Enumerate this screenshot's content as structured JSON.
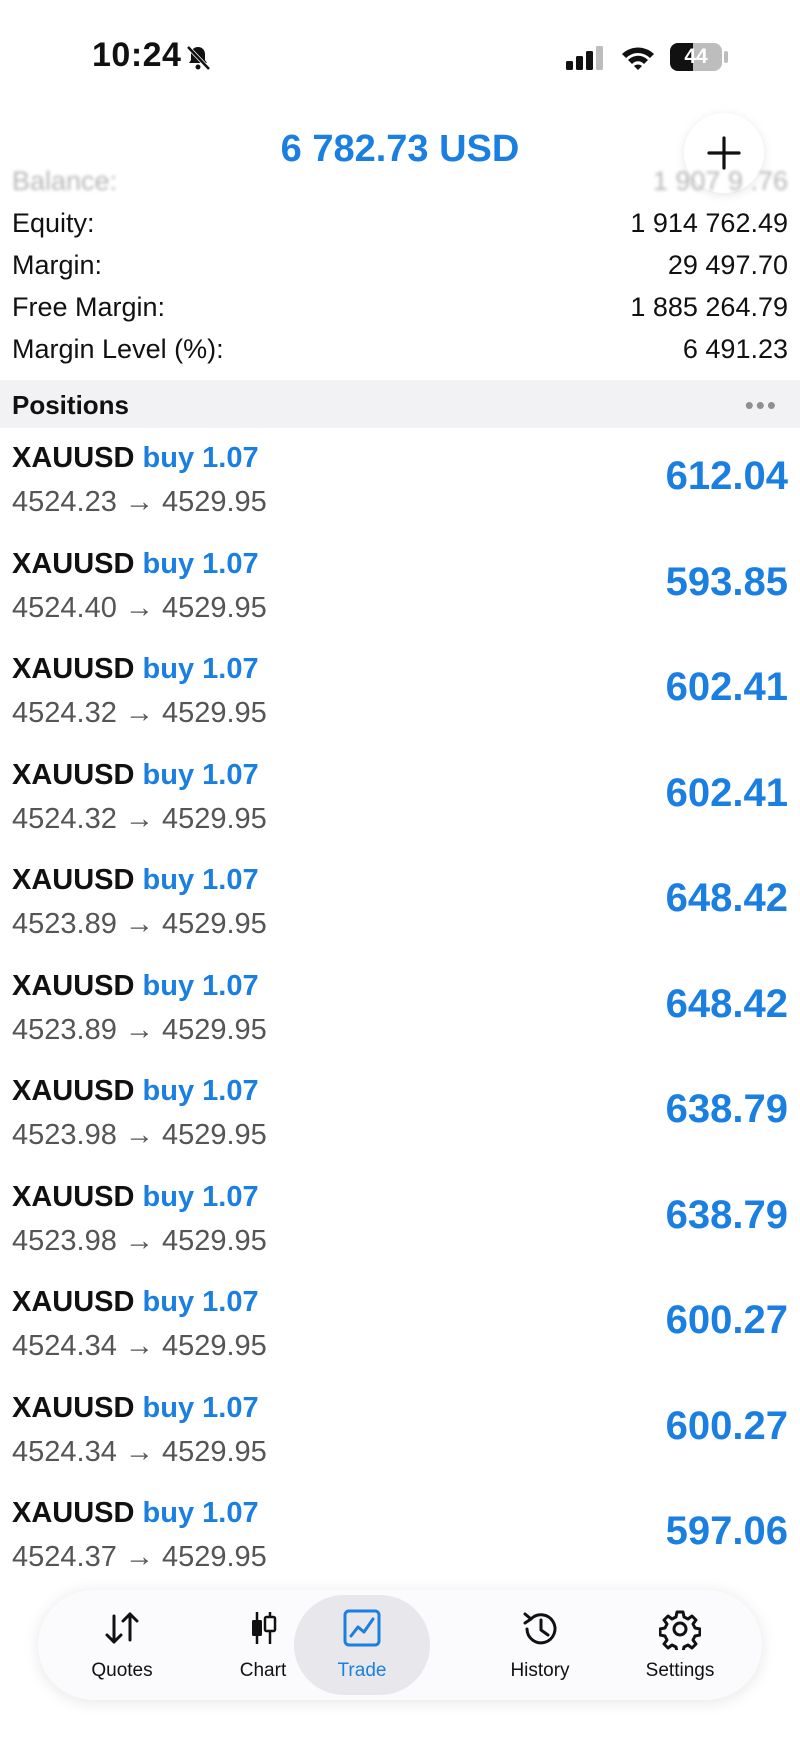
{
  "status_bar": {
    "time": "10:24",
    "battery": "44"
  },
  "header": {
    "total": "6 782.73 USD"
  },
  "account": [
    {
      "label": "Balance:",
      "value": "1 907 9 .76"
    },
    {
      "label": "Equity:",
      "value": "1 914 762.49"
    },
    {
      "label": "Margin:",
      "value": "29 497.70"
    },
    {
      "label": "Free Margin:",
      "value": "1 885 264.79"
    },
    {
      "label": "Margin Level (%):",
      "value": "6 491.23"
    }
  ],
  "positions_title": "Positions",
  "positions": [
    {
      "symbol": "XAUUSD",
      "type": "buy 1.07",
      "prices": "4524.23 → 4529.95",
      "profit": "612.04"
    },
    {
      "symbol": "XAUUSD",
      "type": "buy 1.07",
      "prices": "4524.40 → 4529.95",
      "profit": "593.85"
    },
    {
      "symbol": "XAUUSD",
      "type": "buy 1.07",
      "prices": "4524.32 → 4529.95",
      "profit": "602.41"
    },
    {
      "symbol": "XAUUSD",
      "type": "buy 1.07",
      "prices": "4524.32 → 4529.95",
      "profit": "602.41"
    },
    {
      "symbol": "XAUUSD",
      "type": "buy 1.07",
      "prices": "4523.89 → 4529.95",
      "profit": "648.42"
    },
    {
      "symbol": "XAUUSD",
      "type": "buy 1.07",
      "prices": "4523.89 → 4529.95",
      "profit": "648.42"
    },
    {
      "symbol": "XAUUSD",
      "type": "buy 1.07",
      "prices": "4523.98 → 4529.95",
      "profit": "638.79"
    },
    {
      "symbol": "XAUUSD",
      "type": "buy 1.07",
      "prices": "4523.98 → 4529.95",
      "profit": "638.79"
    },
    {
      "symbol": "XAUUSD",
      "type": "buy 1.07",
      "prices": "4524.34 → 4529.95",
      "profit": "600.27"
    },
    {
      "symbol": "XAUUSD",
      "type": "buy 1.07",
      "prices": "4524.34 → 4529.95",
      "profit": "600.27"
    },
    {
      "symbol": "XAUUSD",
      "type": "buy 1.07",
      "prices": "4524.37 → 4529.95",
      "profit": "597.06"
    }
  ],
  "tabs": [
    {
      "label": "Quotes",
      "icon": "quotes-arrows-icon"
    },
    {
      "label": "Chart",
      "icon": "candlestick-icon"
    },
    {
      "label": "Trade",
      "icon": "trade-chart-icon",
      "active": true
    },
    {
      "label": "History",
      "icon": "history-clock-icon"
    },
    {
      "label": "Settings",
      "icon": "gear-icon"
    }
  ],
  "colors": {
    "accent": "#1a7fe0",
    "text": "#111111",
    "muted": "#555555"
  }
}
